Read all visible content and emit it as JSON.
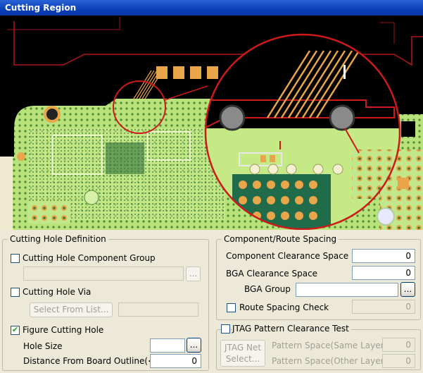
{
  "window": {
    "title": "Cutting Region"
  },
  "cutting_hole": {
    "legend": "Cutting Hole Definition",
    "component_group": {
      "label": "Cutting Hole Component Group",
      "checked": false,
      "value": "",
      "browse": "..."
    },
    "via": {
      "label": "Cutting Hole Via",
      "checked": false,
      "select_label": "Select From List...",
      "value": ""
    },
    "figure": {
      "label": "Figure Cutting Hole",
      "checked": true
    },
    "hole_size": {
      "label": "Hole Size",
      "value": "",
      "browse": "..."
    },
    "distance": {
      "label": "Distance From Board Outline(<)",
      "value": "0"
    }
  },
  "spacing": {
    "legend": "Component/Route Spacing",
    "component_clearance": {
      "label": "Component Clearance Space",
      "value": "0"
    },
    "bga_clearance": {
      "label": "BGA Clearance Space",
      "value": "0"
    },
    "bga_group": {
      "label": "BGA Group",
      "value": "",
      "browse": "..."
    },
    "route_check": {
      "label": "Route Spacing Check",
      "checked": false,
      "value": "0"
    }
  },
  "jtag": {
    "legend": "JTAG Pattern Clearance Test",
    "checked": false,
    "button_line1": "JTAG Net",
    "button_line2": "Select...",
    "same_layer": {
      "label": "Pattern Space(Same Layer)",
      "value": "0"
    },
    "other_layer": {
      "label": "Pattern Space(Other Layer)",
      "value": "0"
    }
  },
  "colors": {
    "board_green": "#b9e27a",
    "highlight_red": "#cc1a1a",
    "trace_orange": "#e8a54a",
    "title_blue": "#0a3fb8"
  }
}
